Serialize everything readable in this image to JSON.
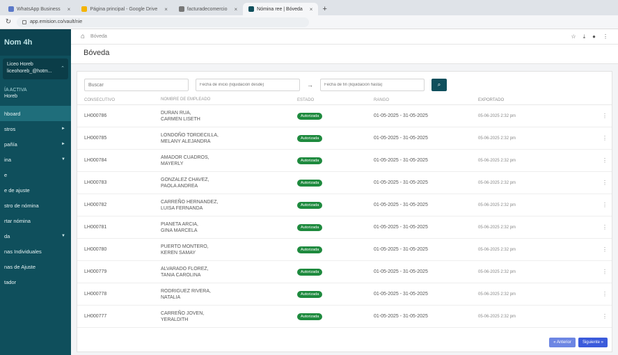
{
  "tabs": [
    {
      "label": "WhatsApp Business",
      "active": false
    },
    {
      "label": "Página principal - Google Drive",
      "active": false
    },
    {
      "label": "facturadecomercio",
      "active": false
    },
    {
      "label": "Nómina ree | Bóveda",
      "active": true
    }
  ],
  "address": {
    "url": "app.emision.co/vault/nie"
  },
  "sidebar": {
    "brand": "Nom 4h",
    "user_name": "Liceo Horeb",
    "user_email": "liceohoreb_@hotm...",
    "company_label": "ÍA ACTIVA",
    "company_name": "Horeb",
    "items": [
      {
        "label": "hboard",
        "arrow": "",
        "active": true
      },
      {
        "label": "stros",
        "arrow": "►",
        "active": false
      },
      {
        "label": "pañía",
        "arrow": "►",
        "active": false
      },
      {
        "label": "ina",
        "arrow": "▼",
        "active": false
      },
      {
        "label": "e",
        "arrow": "",
        "active": false
      },
      {
        "label": "e de ajuste",
        "arrow": "",
        "active": false
      },
      {
        "label": "stro de nómina",
        "arrow": "",
        "active": false
      },
      {
        "label": "rtar nómina",
        "arrow": "",
        "active": false
      },
      {
        "label": "da",
        "arrow": "▼",
        "active": false
      },
      {
        "label": "nas Individuales",
        "arrow": "",
        "active": false
      },
      {
        "label": "nas de Ajuste",
        "arrow": "",
        "active": false
      },
      {
        "label": "tador",
        "arrow": "",
        "active": false
      }
    ]
  },
  "breadcrumb": {
    "label": "Bóveda"
  },
  "page": {
    "title": "Bóveda"
  },
  "filters": {
    "search_placeholder": "Buscar",
    "start_placeholder": "Fecha de inicio (liquidación desde)",
    "end_placeholder": "Fecha de fin (liquidación hasta)"
  },
  "table": {
    "headers": {
      "consecutivo": "CONSECUTIVO",
      "empleado": "NOMBRE DE EMPLEADO",
      "estado": "ESTADO",
      "rango": "RANGO",
      "exportado": "EXPORTADO"
    },
    "rows": [
      {
        "id": "LH000786",
        "name1": "DURAN RUA,",
        "name2": "CARMEN LISETH",
        "estado": "Autorizada",
        "rango": "01-05-2025 - 31-05-2025",
        "exportado": "05-06-2025 2:32 pm"
      },
      {
        "id": "LH000785",
        "name1": "LONDOÑO TORDECILLA,",
        "name2": "MELANY ALEJANDRA",
        "estado": "Autorizada",
        "rango": "01-05-2025 - 31-05-2025",
        "exportado": "05-06-2025 2:32 pm"
      },
      {
        "id": "LH000784",
        "name1": "AMADOR CUADROS,",
        "name2": "MAYERLY",
        "estado": "Autorizada",
        "rango": "01-05-2025 - 31-05-2025",
        "exportado": "05-06-2025 2:32 pm"
      },
      {
        "id": "LH000783",
        "name1": "GONZALEZ CHAVEZ,",
        "name2": "PAOLA ANDREA",
        "estado": "Autorizada",
        "rango": "01-05-2025 - 31-05-2025",
        "exportado": "05-06-2025 2:32 pm"
      },
      {
        "id": "LH000782",
        "name1": "CARREÑO HERNANDEZ,",
        "name2": "LUISA FERNANDA",
        "estado": "Autorizada",
        "rango": "01-05-2025 - 31-05-2025",
        "exportado": "05-06-2025 2:32 pm"
      },
      {
        "id": "LH000781",
        "name1": "PIANETA ARCIA,",
        "name2": "GINA MARCELA",
        "estado": "Autorizada",
        "rango": "01-05-2025 - 31-05-2025",
        "exportado": "05-06-2025 2:32 pm"
      },
      {
        "id": "LH000780",
        "name1": "PUERTO MONTERO,",
        "name2": "KEREN SAMAY",
        "estado": "Autorizada",
        "rango": "01-05-2025 - 31-05-2025",
        "exportado": "05-06-2025 2:32 pm"
      },
      {
        "id": "LH000779",
        "name1": "ALVARADO FLOREZ,",
        "name2": "TANIA CAROLINA",
        "estado": "Autorizada",
        "rango": "01-05-2025 - 31-05-2025",
        "exportado": "05-06-2025 2:32 pm"
      },
      {
        "id": "LH000778",
        "name1": "RODRIGUEZ RIVERA,",
        "name2": "NATALIA",
        "estado": "Autorizada",
        "rango": "01-05-2025 - 31-05-2025",
        "exportado": "05-06-2025 2:32 pm"
      },
      {
        "id": "LH000777",
        "name1": "CARREÑO JOVEN,",
        "name2": "YERALDITH",
        "estado": "Autorizada",
        "rango": "01-05-2025 - 31-05-2025",
        "exportado": "05-06-2025 2:32 pm"
      }
    ]
  },
  "pagination": {
    "prev": "« Anterior",
    "next": "Siguiente »"
  },
  "colors": {
    "sidebar": "#0f4f5c",
    "badge": "#1e8a3e",
    "primary": "#3b5bdb"
  }
}
